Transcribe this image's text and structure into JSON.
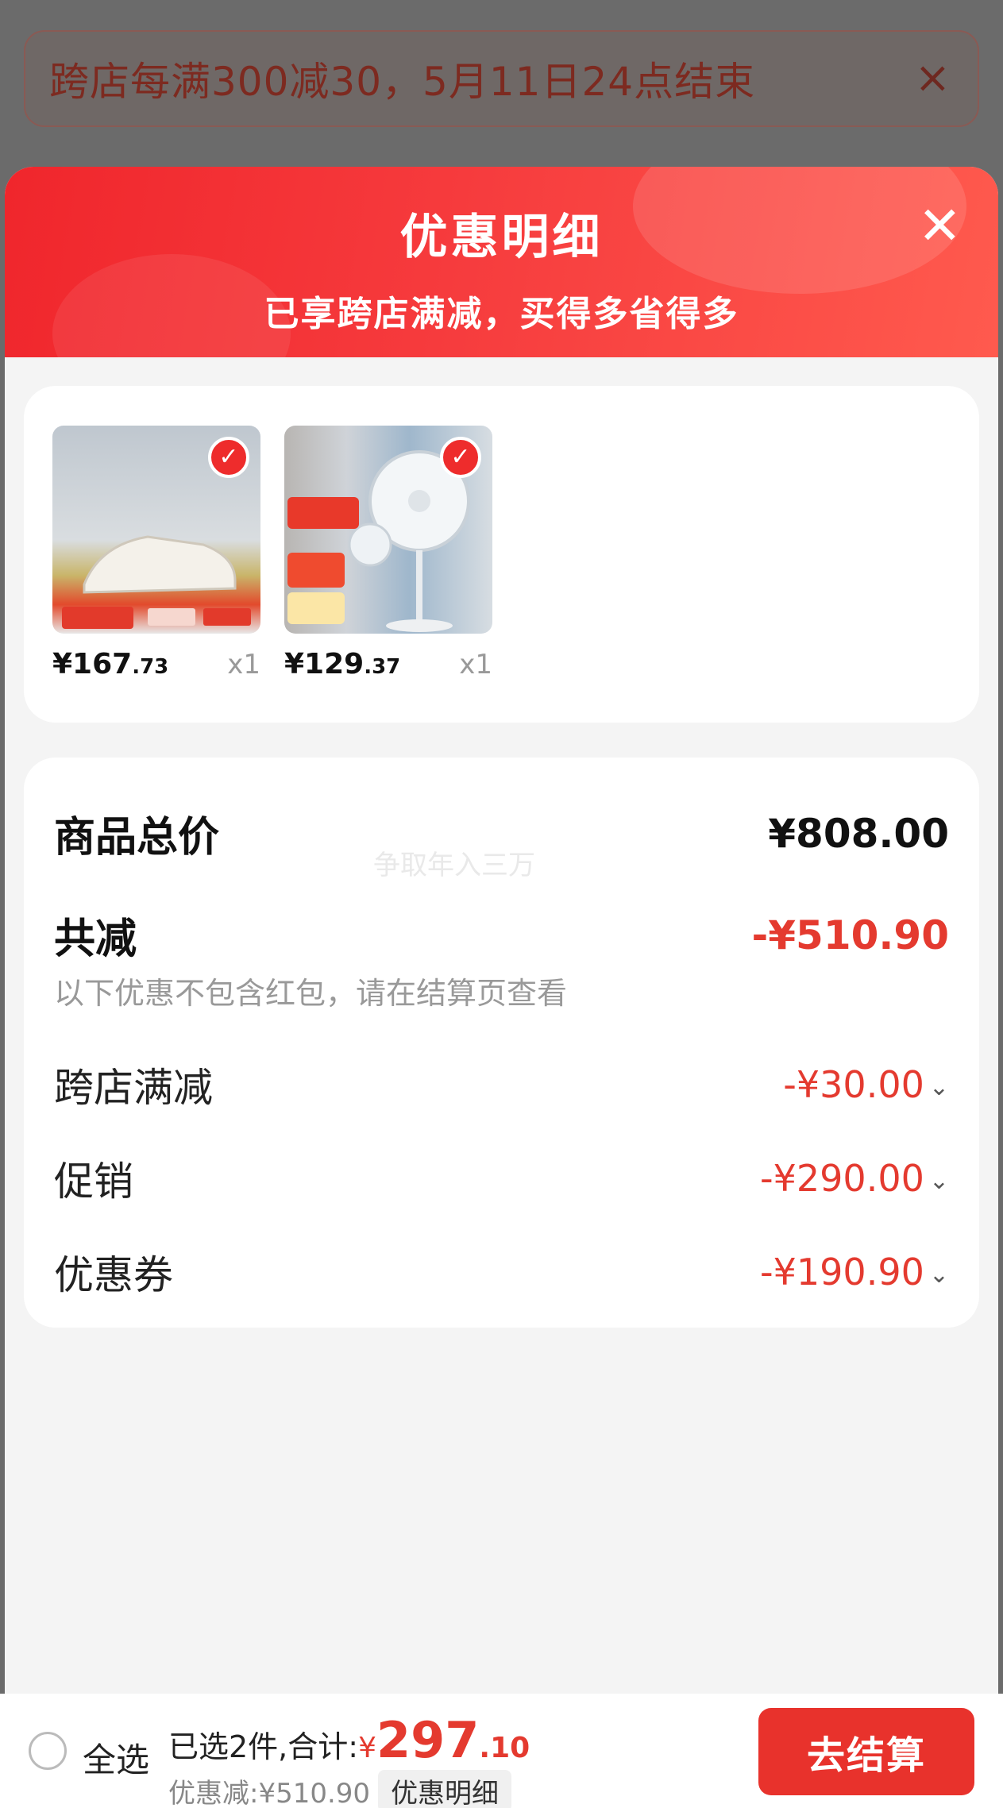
{
  "promo_banner": {
    "text": "跨店每满300减30，5月11日24点结束",
    "close_glyph": "×"
  },
  "sheet": {
    "title": "优惠明细",
    "subtitle": "已享跨店满减，买得多省得多",
    "close_glyph": "✕"
  },
  "products": [
    {
      "icon": "shoe-product-image",
      "price_int": "¥167",
      "price_dec": ".73",
      "qty": "x1"
    },
    {
      "icon": "fan-product-image",
      "price_int": "¥129",
      "price_dec": ".37",
      "qty": "x1"
    }
  ],
  "summary": {
    "total_label": "商品总价",
    "total_value": "¥808.00",
    "discount_label": "共减",
    "discount_value": "-¥510.90",
    "note": "以下优惠不包含红包，请在结算页查看",
    "items": [
      {
        "label": "跨店满减",
        "value": "-¥30.00"
      },
      {
        "label": "促销",
        "value": "-¥290.00"
      },
      {
        "label": "优惠券",
        "value": "-¥190.90"
      }
    ]
  },
  "watermark": "争取年入三万",
  "bottom_bar": {
    "select_all": "全选",
    "selected_text": "已选2件,合计:",
    "currency": "¥",
    "total_int": "297",
    "total_dec": ".10",
    "saved_text": "优惠减:¥510.90",
    "detail_chip": "优惠明细",
    "checkout": "去结算"
  },
  "colors": {
    "accent": "#e8322c",
    "discount_text": "#e43a2f"
  }
}
